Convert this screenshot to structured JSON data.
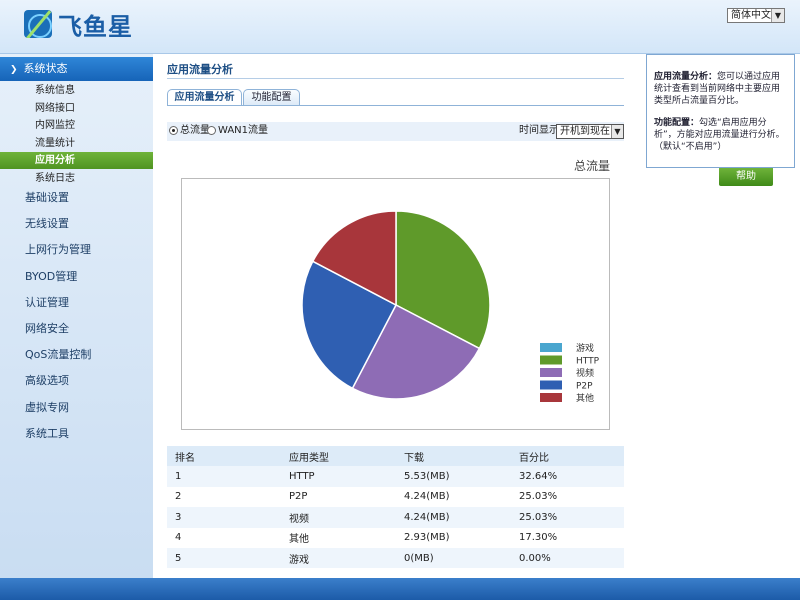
{
  "brand": {
    "name": "飞鱼星"
  },
  "language": {
    "selected": "简体中文"
  },
  "sidebar": {
    "section_title": "系统状态",
    "sub_items": [
      {
        "label": "系统信息",
        "active": false
      },
      {
        "label": "网络接口",
        "active": false
      },
      {
        "label": "内网监控",
        "active": false
      },
      {
        "label": "流量统计",
        "active": false
      },
      {
        "label": "应用分析",
        "active": true
      },
      {
        "label": "系统日志",
        "active": false
      }
    ],
    "menu_items": [
      {
        "label": "基础设置"
      },
      {
        "label": "无线设置"
      },
      {
        "label": "上网行为管理"
      },
      {
        "label": "BYOD管理"
      },
      {
        "label": "认证管理"
      },
      {
        "label": "网络安全"
      },
      {
        "label": "QoS流量控制"
      },
      {
        "label": "高级选项"
      },
      {
        "label": "虚拟专网"
      },
      {
        "label": "系统工具"
      }
    ]
  },
  "main": {
    "title": "应用流量分析",
    "tabs": [
      {
        "label": "应用流量分析",
        "active": true
      },
      {
        "label": "功能配置",
        "active": false
      }
    ],
    "filter": {
      "radio_total": "总流量",
      "radio_wan1": "WAN1流量",
      "selected_radio": "total",
      "time_label": "时间显示",
      "time_value": "开机到现在"
    }
  },
  "chart_data": {
    "type": "pie",
    "title": "总流量",
    "legend_position": "bottom-right",
    "slices": [
      {
        "label": "游戏",
        "value": 0.0,
        "color": "#4aa6cf"
      },
      {
        "label": "HTTP",
        "value": 32.64,
        "color": "#5f9a2a"
      },
      {
        "label": "视频",
        "value": 25.03,
        "color": "#8e6cb5"
      },
      {
        "label": "P2P",
        "value": 25.03,
        "color": "#2f5fb2"
      },
      {
        "label": "其他",
        "value": 17.3,
        "color": "#a8363b"
      }
    ]
  },
  "table": {
    "headers": [
      "排名",
      "应用类型",
      "下载",
      "百分比"
    ],
    "rows": [
      [
        "1",
        "HTTP",
        "5.53(MB)",
        "32.64%"
      ],
      [
        "2",
        "P2P",
        "4.24(MB)",
        "25.03%"
      ],
      [
        "3",
        "视频",
        "4.24(MB)",
        "25.03%"
      ],
      [
        "4",
        "其他",
        "2.93(MB)",
        "17.30%"
      ],
      [
        "5",
        "游戏",
        "0(MB)",
        "0.00%"
      ]
    ]
  },
  "help": {
    "p1_bold": "应用流量分析：",
    "p1_text": "您可以通过应用统计查看到当前网络中主要应用类型所占流量百分比。",
    "p2_bold": "功能配置：",
    "p2_text": "勾选“启用应用分析”，方能对应用流量进行分析。（默认“不启用”）",
    "button_label": "帮助"
  }
}
